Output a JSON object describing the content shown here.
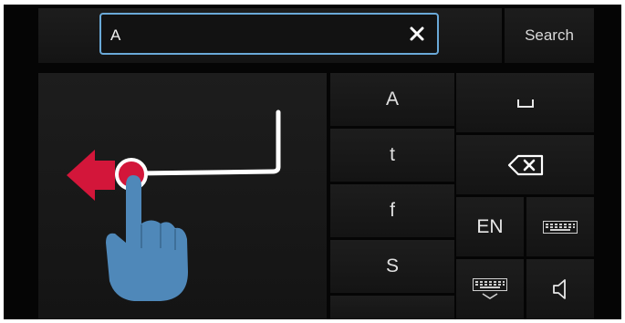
{
  "search": {
    "value": "A",
    "button_label": "Search"
  },
  "handwriting": {
    "icons": [
      "swipe-left-arrow-icon",
      "finger-pointer-icon"
    ]
  },
  "suggestions": [
    "A",
    "t",
    "f",
    "S"
  ],
  "keys": {
    "space": "space-icon",
    "backspace": "backspace-icon",
    "language_label": "EN",
    "keyboard": "keyboard-icon",
    "hide_keyboard": "hide-keyboard-icon",
    "sound": "speaker-icon"
  },
  "colors": {
    "accent_border": "#6aa9d8",
    "arrow_red": "#d3163a",
    "hand_blue": "#4f88b9"
  }
}
